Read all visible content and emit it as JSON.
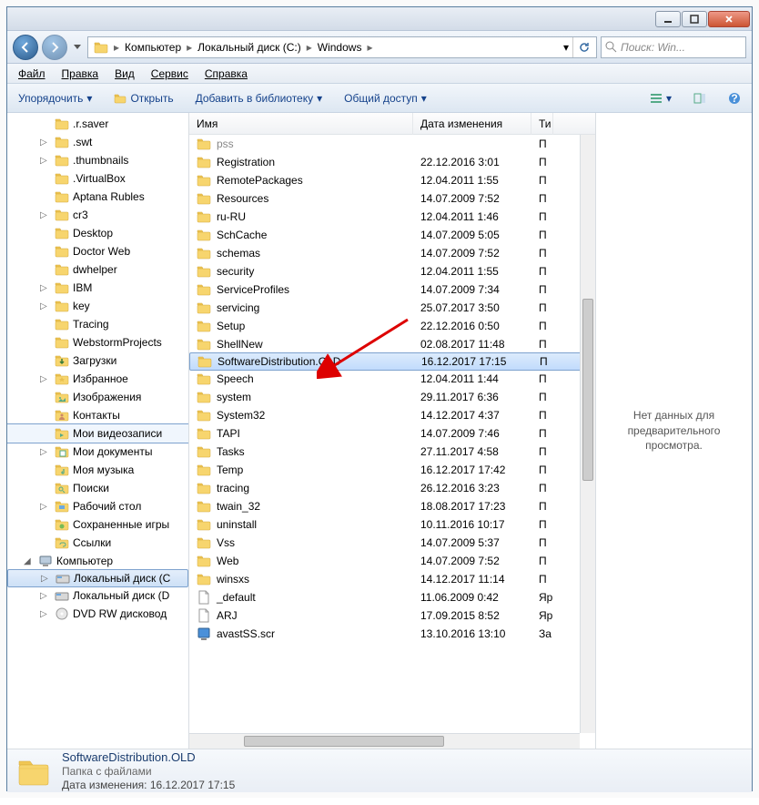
{
  "titlebar": {
    "min": "minimize",
    "max": "maximize",
    "close": "close"
  },
  "breadcrumbs": [
    "Компьютер",
    "Локальный диск (C:)",
    "Windows"
  ],
  "search_placeholder": "Поиск: Win...",
  "menu": {
    "file": "Файл",
    "edit": "Правка",
    "view": "Вид",
    "tools": "Сервис",
    "help": "Справка"
  },
  "toolbar": {
    "organize": "Упорядочить",
    "open": "Открыть",
    "addlib": "Добавить в библиотеку",
    "share": "Общий доступ"
  },
  "columns": {
    "name": "Имя",
    "date": "Дата изменения",
    "type": "Ти"
  },
  "preview_text": "Нет данных для предварительного просмотра.",
  "tree": [
    {
      "lvl": 2,
      "icon": "folder",
      "label": ".r.saver",
      "exp": ""
    },
    {
      "lvl": 2,
      "icon": "folder",
      "label": ".swt",
      "exp": "▷"
    },
    {
      "lvl": 2,
      "icon": "folder",
      "label": ".thumbnails",
      "exp": "▷"
    },
    {
      "lvl": 2,
      "icon": "folder",
      "label": ".VirtualBox",
      "exp": ""
    },
    {
      "lvl": 2,
      "icon": "folder",
      "label": "Aptana Rubles",
      "exp": ""
    },
    {
      "lvl": 2,
      "icon": "folder",
      "label": "cr3",
      "exp": "▷"
    },
    {
      "lvl": 2,
      "icon": "folder",
      "label": "Desktop",
      "exp": ""
    },
    {
      "lvl": 2,
      "icon": "folder",
      "label": "Doctor Web",
      "exp": ""
    },
    {
      "lvl": 2,
      "icon": "folder",
      "label": "dwhelper",
      "exp": ""
    },
    {
      "lvl": 2,
      "icon": "folder",
      "label": "IBM",
      "exp": "▷"
    },
    {
      "lvl": 2,
      "icon": "folder",
      "label": "key",
      "exp": "▷"
    },
    {
      "lvl": 2,
      "icon": "folder",
      "label": "Tracing",
      "exp": ""
    },
    {
      "lvl": 2,
      "icon": "folder",
      "label": "WebstormProjects",
      "exp": ""
    },
    {
      "lvl": 2,
      "icon": "downloads",
      "label": "Загрузки",
      "exp": ""
    },
    {
      "lvl": 2,
      "icon": "favorites",
      "label": "Избранное",
      "exp": "▷"
    },
    {
      "lvl": 2,
      "icon": "pictures",
      "label": "Изображения",
      "exp": ""
    },
    {
      "lvl": 2,
      "icon": "contacts",
      "label": "Контакты",
      "exp": ""
    },
    {
      "lvl": 2,
      "icon": "videos",
      "label": "Мои видеозаписи",
      "exp": "",
      "hilite": true
    },
    {
      "lvl": 2,
      "icon": "docs",
      "label": "Мои документы",
      "exp": "▷"
    },
    {
      "lvl": 2,
      "icon": "music",
      "label": "Моя музыка",
      "exp": ""
    },
    {
      "lvl": 2,
      "icon": "search",
      "label": "Поиски",
      "exp": ""
    },
    {
      "lvl": 2,
      "icon": "desktop",
      "label": "Рабочий стол",
      "exp": "▷"
    },
    {
      "lvl": 2,
      "icon": "games",
      "label": "Сохраненные игры",
      "exp": ""
    },
    {
      "lvl": 2,
      "icon": "links",
      "label": "Ссылки",
      "exp": ""
    },
    {
      "lvl": 1,
      "icon": "computer",
      "label": "Компьютер",
      "exp": "◢"
    },
    {
      "lvl": 2,
      "icon": "drive",
      "label": "Локальный диск (C",
      "exp": "▷",
      "sel": true
    },
    {
      "lvl": 2,
      "icon": "drive",
      "label": "Локальный диск (D",
      "exp": "▷"
    },
    {
      "lvl": 2,
      "icon": "dvd",
      "label": "DVD RW дисковод",
      "exp": "▷"
    }
  ],
  "files": [
    {
      "name": "pss",
      "date": "",
      "type": "П",
      "icon": "folder",
      "cut": true
    },
    {
      "name": "Registration",
      "date": "22.12.2016 3:01",
      "type": "П",
      "icon": "folder"
    },
    {
      "name": "RemotePackages",
      "date": "12.04.2011 1:55",
      "type": "П",
      "icon": "folder"
    },
    {
      "name": "Resources",
      "date": "14.07.2009 7:52",
      "type": "П",
      "icon": "folder"
    },
    {
      "name": "ru-RU",
      "date": "12.04.2011 1:46",
      "type": "П",
      "icon": "folder"
    },
    {
      "name": "SchCache",
      "date": "14.07.2009 5:05",
      "type": "П",
      "icon": "folder"
    },
    {
      "name": "schemas",
      "date": "14.07.2009 7:52",
      "type": "П",
      "icon": "folder"
    },
    {
      "name": "security",
      "date": "12.04.2011 1:55",
      "type": "П",
      "icon": "folder"
    },
    {
      "name": "ServiceProfiles",
      "date": "14.07.2009 7:34",
      "type": "П",
      "icon": "folder"
    },
    {
      "name": "servicing",
      "date": "25.07.2017 3:50",
      "type": "П",
      "icon": "folder"
    },
    {
      "name": "Setup",
      "date": "22.12.2016 0:50",
      "type": "П",
      "icon": "folder"
    },
    {
      "name": "ShellNew",
      "date": "02.08.2017 11:48",
      "type": "П",
      "icon": "folder"
    },
    {
      "name": "SoftwareDistribution.OLD",
      "date": "16.12.2017 17:15",
      "type": "П",
      "icon": "folder",
      "selected": true
    },
    {
      "name": "Speech",
      "date": "12.04.2011 1:44",
      "type": "П",
      "icon": "folder"
    },
    {
      "name": "system",
      "date": "29.11.2017 6:36",
      "type": "П",
      "icon": "folder"
    },
    {
      "name": "System32",
      "date": "14.12.2017 4:37",
      "type": "П",
      "icon": "folder"
    },
    {
      "name": "TAPI",
      "date": "14.07.2009 7:46",
      "type": "П",
      "icon": "folder"
    },
    {
      "name": "Tasks",
      "date": "27.11.2017 4:58",
      "type": "П",
      "icon": "folder"
    },
    {
      "name": "Temp",
      "date": "16.12.2017 17:42",
      "type": "П",
      "icon": "folder"
    },
    {
      "name": "tracing",
      "date": "26.12.2016 3:23",
      "type": "П",
      "icon": "folder"
    },
    {
      "name": "twain_32",
      "date": "18.08.2017 17:23",
      "type": "П",
      "icon": "folder"
    },
    {
      "name": "uninstall",
      "date": "10.11.2016 10:17",
      "type": "П",
      "icon": "folder"
    },
    {
      "name": "Vss",
      "date": "14.07.2009 5:37",
      "type": "П",
      "icon": "folder"
    },
    {
      "name": "Web",
      "date": "14.07.2009 7:52",
      "type": "П",
      "icon": "folder"
    },
    {
      "name": "winsxs",
      "date": "14.12.2017 11:14",
      "type": "П",
      "icon": "folder"
    },
    {
      "name": "_default",
      "date": "11.06.2009 0:42",
      "type": "Яр",
      "icon": "file"
    },
    {
      "name": "ARJ",
      "date": "17.09.2015 8:52",
      "type": "Яр",
      "icon": "file"
    },
    {
      "name": "avastSS.scr",
      "date": "13.10.2016 13:10",
      "type": "За",
      "icon": "scr"
    }
  ],
  "details": {
    "name": "SoftwareDistribution.OLD",
    "type": "Папка с файлами",
    "date_label": "Дата изменения:",
    "date": "16.12.2017 17:15"
  }
}
